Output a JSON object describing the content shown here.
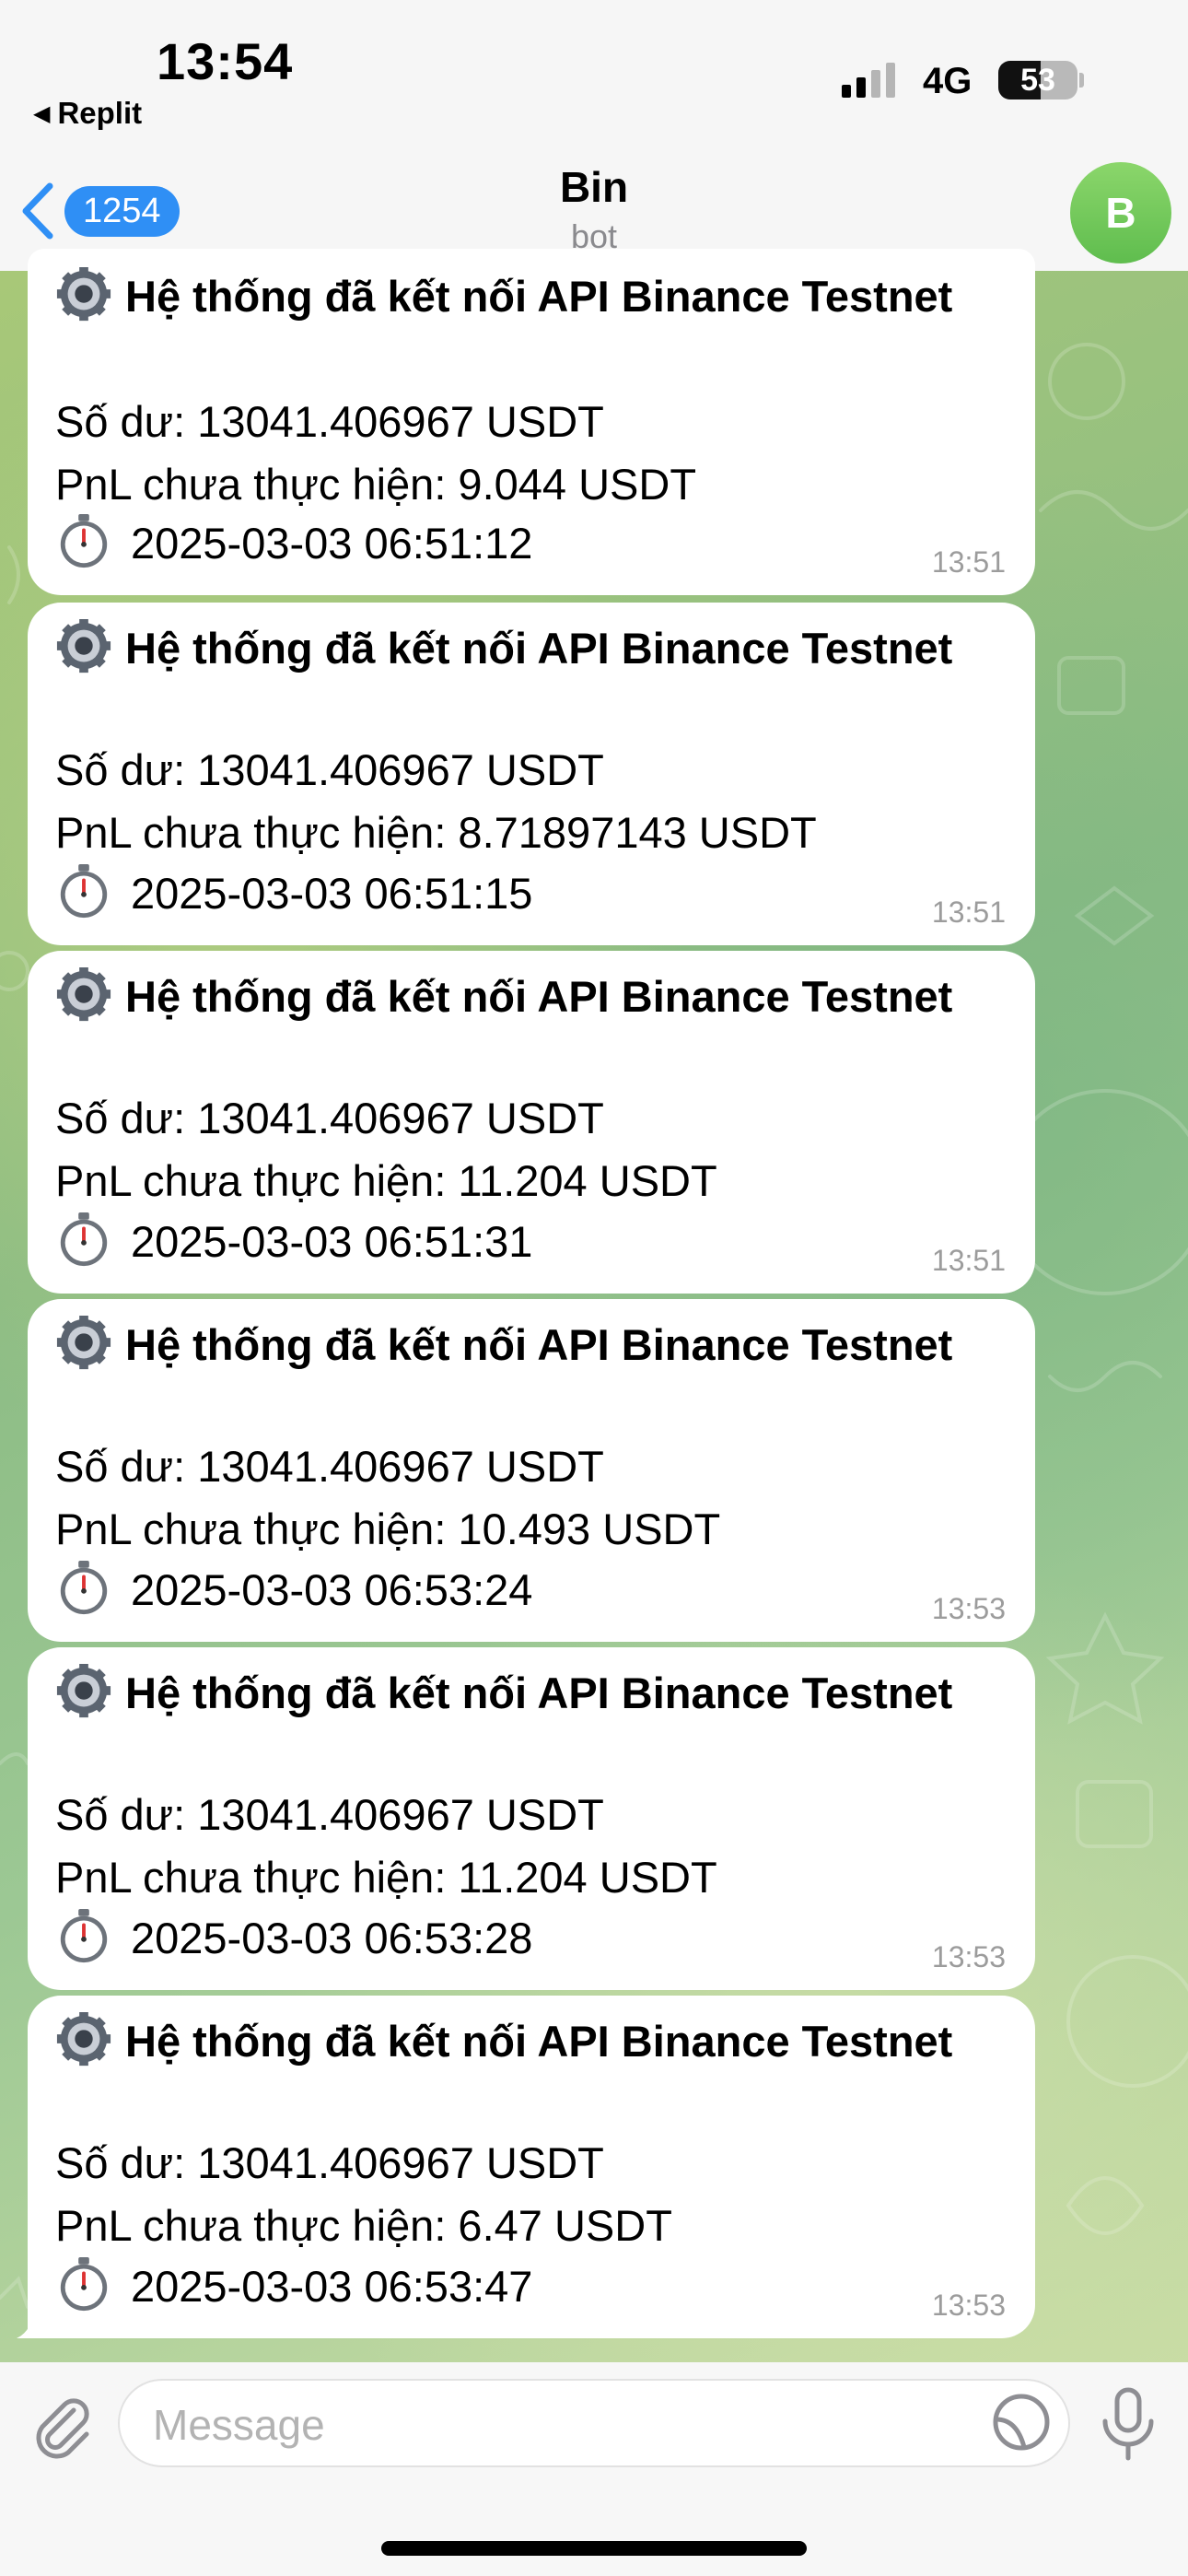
{
  "status_bar": {
    "time": "13:54",
    "back_app": "Replit",
    "network": "4G",
    "battery": "53",
    "battery_level_percent": 53
  },
  "header": {
    "unread_count": "1254",
    "title": "Bin",
    "subtitle": "bot",
    "avatar_letter": "B"
  },
  "messages": [
    {
      "heading": "Hệ thống đã kết nối API Binance Testnet",
      "balance": "Số dư: 13041.406967 USDT",
      "pnl": "PnL chưa thực hiện: 9.044 USDT",
      "timestamp": "2025-03-03 06:51:12",
      "sent_time": "13:51"
    },
    {
      "heading": "Hệ thống đã kết nối API Binance Testnet",
      "balance": "Số dư: 13041.406967 USDT",
      "pnl": "PnL chưa thực hiện: 8.71897143 USDT",
      "timestamp": "2025-03-03 06:51:15",
      "sent_time": "13:51"
    },
    {
      "heading": "Hệ thống đã kết nối API Binance Testnet",
      "balance": "Số dư: 13041.406967 USDT",
      "pnl": "PnL chưa thực hiện: 11.204 USDT",
      "timestamp": "2025-03-03 06:51:31",
      "sent_time": "13:51"
    },
    {
      "heading": "Hệ thống đã kết nối API Binance Testnet",
      "balance": "Số dư: 13041.406967 USDT",
      "pnl": "PnL chưa thực hiện: 10.493 USDT",
      "timestamp": "2025-03-03 06:53:24",
      "sent_time": "13:53"
    },
    {
      "heading": "Hệ thống đã kết nối API Binance Testnet",
      "balance": "Số dư: 13041.406967 USDT",
      "pnl": "PnL chưa thực hiện: 11.204 USDT",
      "timestamp": "2025-03-03 06:53:28",
      "sent_time": "13:53"
    },
    {
      "heading": "Hệ thống đã kết nối API Binance Testnet",
      "balance": "Số dư: 13041.406967 USDT",
      "pnl": "PnL chưa thực hiện: 6.47 USDT",
      "timestamp": "2025-03-03 06:53:47",
      "sent_time": "13:53"
    }
  ],
  "input": {
    "placeholder": "Message"
  },
  "icons": {
    "heading_icon": "gear-icon",
    "timestamp_icon": "stopwatch-icon",
    "attach": "paperclip-icon",
    "sticker": "sticker-icon",
    "voice": "microphone-icon",
    "back": "chevron-left-icon"
  },
  "colors": {
    "accent": "#2f8ff5",
    "avatar": "#6cc653",
    "bubble": "#ffffff"
  }
}
